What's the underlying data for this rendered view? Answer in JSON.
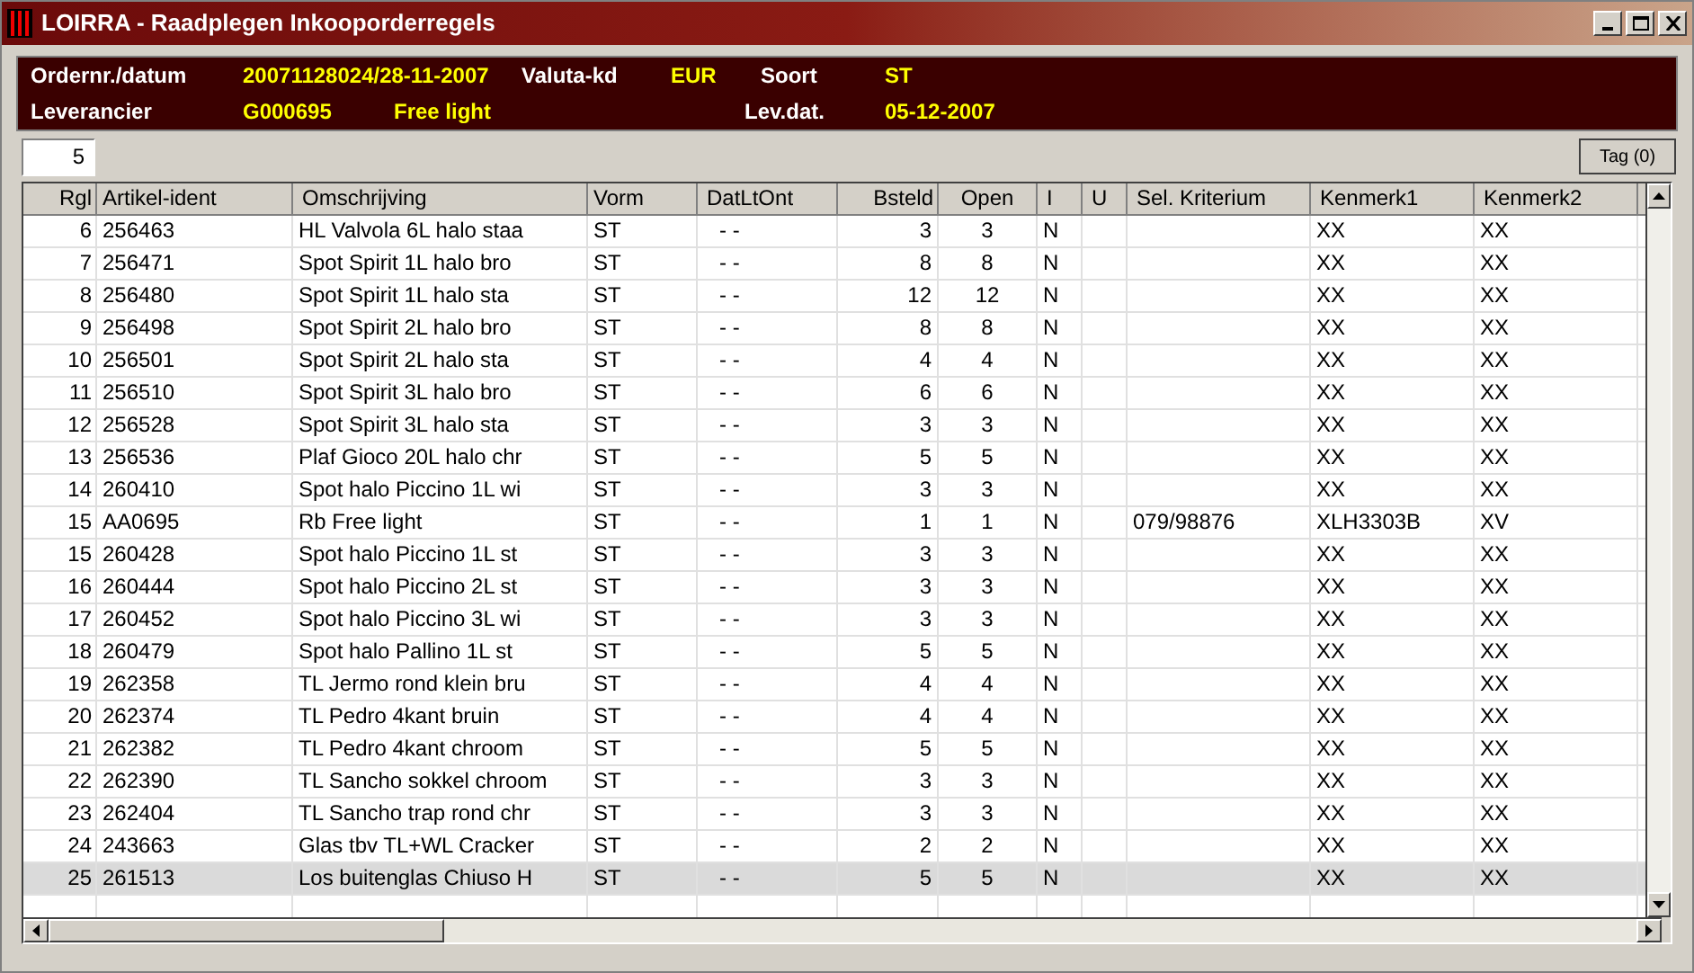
{
  "window": {
    "title": "LOIRRA - Raadplegen Inkooporderregels"
  },
  "header": {
    "row_1": [
      {
        "kind": "label",
        "text": "Ordernr./datum"
      },
      {
        "kind": "value",
        "text": "20071128024/28-11-2007"
      },
      {
        "kind": "label",
        "text": "Valuta-kd"
      },
      {
        "kind": "value",
        "text": "EUR"
      },
      {
        "kind": "label",
        "text": "Soort"
      },
      {
        "kind": "value",
        "text": "ST"
      }
    ],
    "row_2": [
      {
        "kind": "label",
        "text": "Leverancier"
      },
      {
        "kind": "value",
        "text": "G000695"
      },
      {
        "kind": "value",
        "text": "Free light"
      },
      {
        "kind": "label",
        "text": "Lev.dat."
      },
      {
        "kind": "value",
        "text": "05-12-2007"
      }
    ]
  },
  "toolbar": {
    "count_field": {
      "value": "5"
    },
    "tag_button": "Tag (0)"
  },
  "table": {
    "columns": [
      "Rgl",
      "Artikel-ident",
      "Omschrijving",
      "Vorm",
      "DatLtOnt",
      "Bsteld",
      "Open",
      "I",
      "U",
      "Sel. Kriterium",
      "Kenmerk1",
      "Kenmerk2"
    ],
    "rows": [
      {
        "selected": false,
        "cells": [
          "6",
          "256463",
          "HL Valvola 6L halo staa",
          "ST",
          "- -",
          "3",
          "3",
          "N",
          "",
          "",
          "XX",
          "XX"
        ]
      },
      {
        "selected": false,
        "cells": [
          "7",
          "256471",
          "Spot Spirit 1L halo bro",
          "ST",
          "- -",
          "8",
          "8",
          "N",
          "",
          "",
          "XX",
          "XX"
        ]
      },
      {
        "selected": false,
        "cells": [
          "8",
          "256480",
          "Spot Spirit 1L halo sta",
          "ST",
          "- -",
          "12",
          "12",
          "N",
          "",
          "",
          "XX",
          "XX"
        ]
      },
      {
        "selected": false,
        "cells": [
          "9",
          "256498",
          "Spot Spirit 2L halo bro",
          "ST",
          "- -",
          "8",
          "8",
          "N",
          "",
          "",
          "XX",
          "XX"
        ]
      },
      {
        "selected": false,
        "cells": [
          "10",
          "256501",
          "Spot Spirit 2L halo sta",
          "ST",
          "- -",
          "4",
          "4",
          "N",
          "",
          "",
          "XX",
          "XX"
        ]
      },
      {
        "selected": false,
        "cells": [
          "11",
          "256510",
          "Spot Spirit 3L halo bro",
          "ST",
          "- -",
          "6",
          "6",
          "N",
          "",
          "",
          "XX",
          "XX"
        ]
      },
      {
        "selected": false,
        "cells": [
          "12",
          "256528",
          "Spot Spirit 3L halo sta",
          "ST",
          "- -",
          "3",
          "3",
          "N",
          "",
          "",
          "XX",
          "XX"
        ]
      },
      {
        "selected": false,
        "cells": [
          "13",
          "256536",
          "Plaf Gioco 20L halo chr",
          "ST",
          "- -",
          "5",
          "5",
          "N",
          "",
          "",
          "XX",
          "XX"
        ]
      },
      {
        "selected": false,
        "cells": [
          "14",
          "260410",
          "Spot halo Piccino 1L wi",
          "ST",
          "- -",
          "3",
          "3",
          "N",
          "",
          "",
          "XX",
          "XX"
        ]
      },
      {
        "selected": false,
        "cells": [
          "15",
          "AA0695",
          "Rb Free light",
          "ST",
          "- -",
          "1",
          "1",
          "N",
          "",
          "079/98876",
          "XLH3303B",
          "XV"
        ]
      },
      {
        "selected": false,
        "cells": [
          "15",
          "260428",
          "Spot halo Piccino 1L st",
          "ST",
          "- -",
          "3",
          "3",
          "N",
          "",
          "",
          "XX",
          "XX"
        ]
      },
      {
        "selected": false,
        "cells": [
          "16",
          "260444",
          "Spot halo Piccino 2L st",
          "ST",
          "- -",
          "3",
          "3",
          "N",
          "",
          "",
          "XX",
          "XX"
        ]
      },
      {
        "selected": false,
        "cells": [
          "17",
          "260452",
          "Spot halo Piccino 3L wi",
          "ST",
          "- -",
          "3",
          "3",
          "N",
          "",
          "",
          "XX",
          "XX"
        ]
      },
      {
        "selected": false,
        "cells": [
          "18",
          "260479",
          "Spot halo Pallino 1L st",
          "ST",
          "- -",
          "5",
          "5",
          "N",
          "",
          "",
          "XX",
          "XX"
        ]
      },
      {
        "selected": false,
        "cells": [
          "19",
          "262358",
          "TL Jermo rond klein bru",
          "ST",
          "- -",
          "4",
          "4",
          "N",
          "",
          "",
          "XX",
          "XX"
        ]
      },
      {
        "selected": false,
        "cells": [
          "20",
          "262374",
          "TL Pedro 4kant bruin",
          "ST",
          "- -",
          "4",
          "4",
          "N",
          "",
          "",
          "XX",
          "XX"
        ]
      },
      {
        "selected": false,
        "cells": [
          "21",
          "262382",
          "TL Pedro 4kant chroom",
          "ST",
          "- -",
          "5",
          "5",
          "N",
          "",
          "",
          "XX",
          "XX"
        ]
      },
      {
        "selected": false,
        "cells": [
          "22",
          "262390",
          "TL Sancho sokkel chroom",
          "ST",
          "- -",
          "3",
          "3",
          "N",
          "",
          "",
          "XX",
          "XX"
        ]
      },
      {
        "selected": false,
        "cells": [
          "23",
          "262404",
          "TL Sancho trap rond chr",
          "ST",
          "- -",
          "3",
          "3",
          "N",
          "",
          "",
          "XX",
          "XX"
        ]
      },
      {
        "selected": false,
        "cells": [
          "24",
          "243663",
          "Glas tbv TL+WL Cracker",
          "ST",
          "- -",
          "2",
          "2",
          "N",
          "",
          "",
          "XX",
          "XX"
        ]
      },
      {
        "selected": true,
        "cells": [
          "25",
          "261513",
          "Los buitenglas Chiuso H",
          "ST",
          "- -",
          "5",
          "5",
          "N",
          "",
          "",
          "XX",
          "XX"
        ]
      }
    ]
  }
}
